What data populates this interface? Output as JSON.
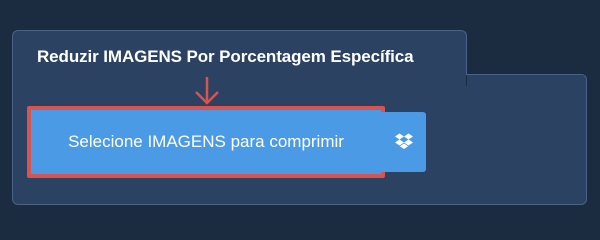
{
  "panel": {
    "title": "Reduzir IMAGENS Por Porcentagem Específica"
  },
  "upload": {
    "label": "Selecione IMAGENS para comprimir"
  },
  "icons": {
    "dropbox": "dropbox-icon",
    "arrow": "arrow-down-icon"
  },
  "colors": {
    "background": "#1b2b40",
    "panel": "#2b4263",
    "button": "#4a9ae6",
    "highlight": "#d9534f"
  }
}
